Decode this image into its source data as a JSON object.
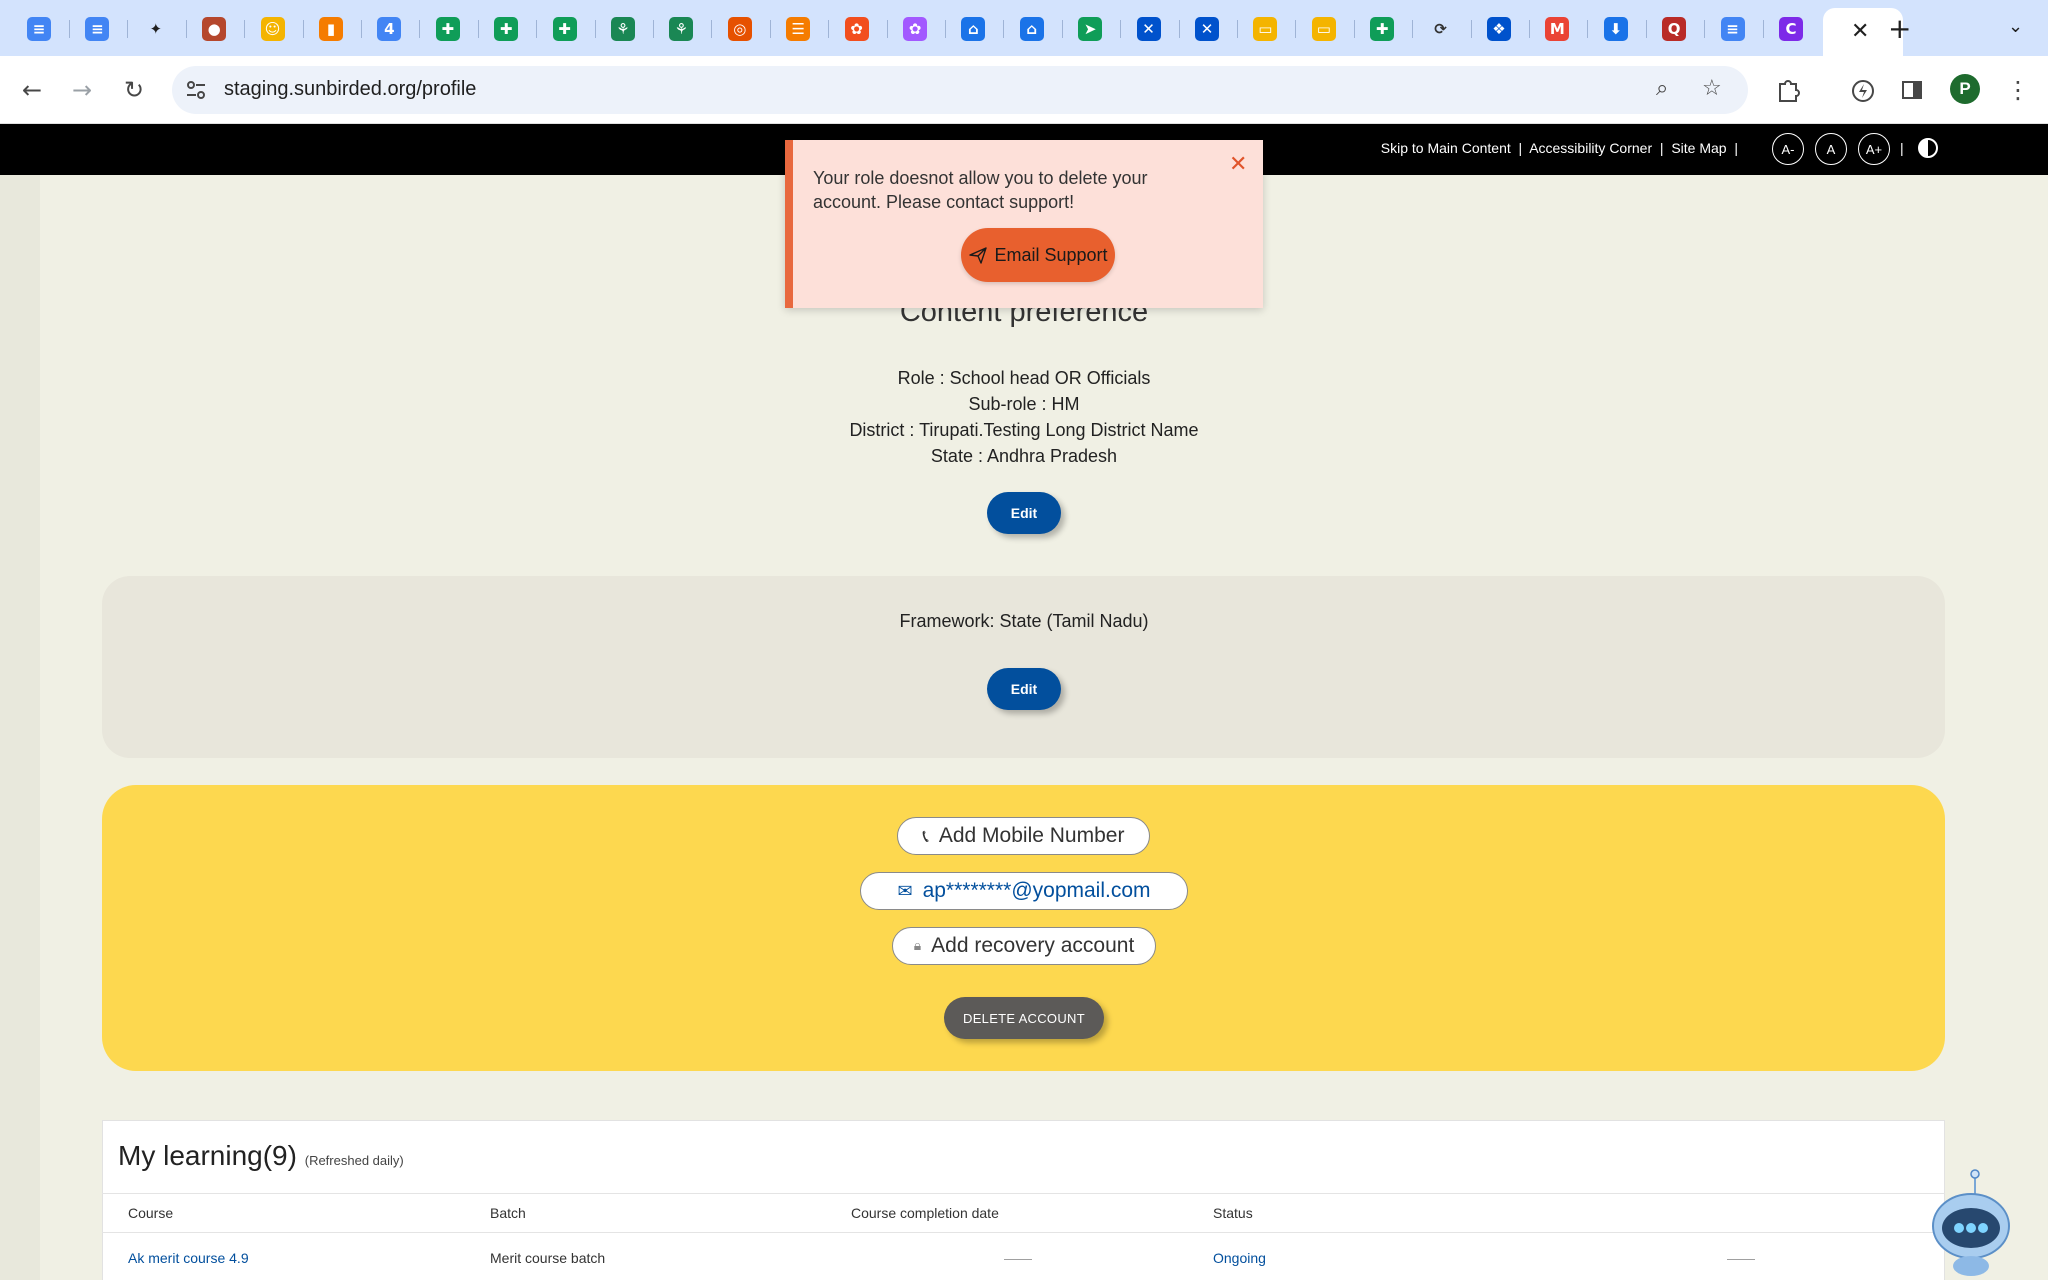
{
  "browser": {
    "url": "staging.sunbirded.org/profile",
    "profile_initial": "P",
    "tabs": [
      {
        "icon": "docs-icon",
        "color": "#4285f4"
      },
      {
        "icon": "docs-icon",
        "color": "#4285f4"
      },
      {
        "icon": "gemini-icon",
        "color": "#1f1f1f"
      },
      {
        "icon": "circle-app-icon",
        "color": "#b5472d"
      },
      {
        "icon": "emoji-icon",
        "color": "#f4b400"
      },
      {
        "icon": "bookmark-app-icon",
        "color": "#f57c00"
      },
      {
        "icon": "calendar-icon",
        "color": "#4285f4"
      },
      {
        "icon": "sheets-icon",
        "color": "#0f9d58"
      },
      {
        "icon": "sheets-icon",
        "color": "#0f9d58"
      },
      {
        "icon": "sheets-icon",
        "color": "#0f9d58"
      },
      {
        "icon": "leaf-app-icon",
        "color": "#1a8754"
      },
      {
        "icon": "leaf-app-icon",
        "color": "#1a8754"
      },
      {
        "icon": "emblem-icon",
        "color": "#e65100"
      },
      {
        "icon": "stack-app-icon",
        "color": "#f57c00"
      },
      {
        "icon": "figma-icon",
        "color": "#f24e1e"
      },
      {
        "icon": "figma-icon",
        "color": "#a259ff"
      },
      {
        "icon": "home-app-icon",
        "color": "#1a73e8"
      },
      {
        "icon": "home-app-icon",
        "color": "#1a73e8"
      },
      {
        "icon": "route-app-icon",
        "color": "#0f9d58"
      },
      {
        "icon": "confluence-icon",
        "color": "#0052cc"
      },
      {
        "icon": "confluence-icon",
        "color": "#0052cc"
      },
      {
        "icon": "slides-icon",
        "color": "#f4b400"
      },
      {
        "icon": "slides-icon",
        "color": "#f4b400"
      },
      {
        "icon": "sheets-icon",
        "color": "#0f9d58"
      },
      {
        "icon": "sync-app-icon",
        "color": "#333333"
      },
      {
        "icon": "jira-icon",
        "color": "#0052cc"
      },
      {
        "icon": "gmail-icon",
        "color": "#ea4335"
      },
      {
        "icon": "download-icon",
        "color": "#1a73e8"
      },
      {
        "icon": "quora-icon",
        "color": "#b92b27"
      },
      {
        "icon": "docs-icon",
        "color": "#4285f4"
      },
      {
        "icon": "canva-icon",
        "color": "#7d2ae8"
      }
    ]
  },
  "site_header": {
    "skip_link": "Skip to Main Content",
    "accessibility_link": "Accessibility Corner",
    "sitemap_link": "Site Map",
    "font_decrease": "A-",
    "font_normal": "A",
    "font_increase": "A+"
  },
  "toast": {
    "message": "Your role doesnot allow you to delete your account. Please contact support!",
    "button_label": "Email Support"
  },
  "content_preference": {
    "title": "Content preference",
    "role": "Role : School head OR Officials",
    "sub_role": "Sub-role : HM",
    "district": "District : Tirupati.Testing Long District Name",
    "state": "State : Andhra Pradesh",
    "edit_label": "Edit"
  },
  "framework": {
    "text": "Framework: State (Tamil Nadu)",
    "edit_label": "Edit"
  },
  "contact": {
    "mobile_label": "Add Mobile Number",
    "email": "ap********@yopmail.com",
    "recovery_label": "Add recovery account",
    "delete_label": "DELETE ACCOUNT"
  },
  "learning": {
    "title": "My learning(9)",
    "subtitle": "(Refreshed daily)",
    "columns": [
      "Course",
      "Batch",
      "Course completion date",
      "Status"
    ],
    "rows": [
      {
        "course": "Ak merit course 4.9",
        "batch": "Merit course batch",
        "completion": "——",
        "status": "Ongoing",
        "extra": "——"
      }
    ]
  },
  "colors": {
    "primary_blue": "#024f9d",
    "toast_accent": "#e8683e",
    "contact_card": "#fdd84f"
  }
}
